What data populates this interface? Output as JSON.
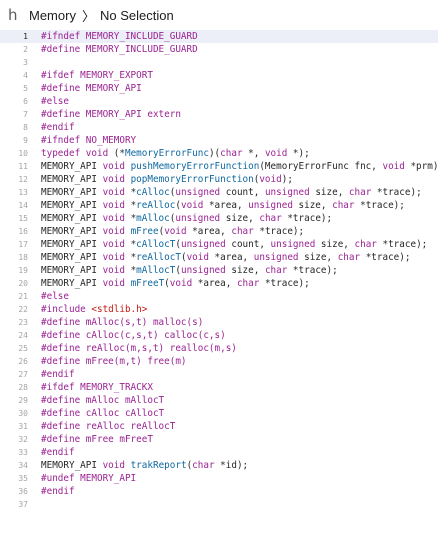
{
  "breadcrumb": {
    "file_icon": "h",
    "file": "Memory",
    "chevron": "〉",
    "selection": "No Selection"
  },
  "code": {
    "current_line": 1,
    "lines": [
      {
        "n": "1",
        "tokens": [
          {
            "t": "#ifndef MEMORY_INCLUDE_GUARD",
            "c": "k"
          }
        ]
      },
      {
        "n": "2",
        "tokens": [
          {
            "t": "#define MEMORY_INCLUDE_GUARD",
            "c": "k"
          }
        ]
      },
      {
        "n": "3",
        "tokens": []
      },
      {
        "n": "4",
        "tokens": [
          {
            "t": "#ifdef MEMORY_EXPORT",
            "c": "k"
          }
        ]
      },
      {
        "n": "5",
        "tokens": [
          {
            "t": "#define MEMORY_API",
            "c": "k"
          }
        ]
      },
      {
        "n": "6",
        "tokens": [
          {
            "t": "#else",
            "c": "k"
          }
        ]
      },
      {
        "n": "7",
        "tokens": [
          {
            "t": "#define MEMORY_API extern",
            "c": "k"
          }
        ]
      },
      {
        "n": "8",
        "tokens": [
          {
            "t": "#endif",
            "c": "k"
          }
        ]
      },
      {
        "n": "9",
        "tokens": [
          {
            "t": "#ifndef NO_MEMORY",
            "c": "k"
          }
        ]
      },
      {
        "n": "10",
        "tokens": [
          {
            "t": "typedef",
            "c": "k"
          },
          {
            "t": " ",
            "c": "p"
          },
          {
            "t": "void",
            "c": "k"
          },
          {
            "t": " (*",
            "c": "p"
          },
          {
            "t": "MemoryErrorFunc",
            "c": "f"
          },
          {
            "t": ")(",
            "c": "p"
          },
          {
            "t": "char",
            "c": "k"
          },
          {
            "t": " *, ",
            "c": "p"
          },
          {
            "t": "void",
            "c": "k"
          },
          {
            "t": " *);",
            "c": "p"
          }
        ]
      },
      {
        "n": "11",
        "tokens": [
          {
            "t": "MEMORY_API ",
            "c": "p"
          },
          {
            "t": "void",
            "c": "k"
          },
          {
            "t": " ",
            "c": "p"
          },
          {
            "t": "pushMemoryErrorFunction",
            "c": "f"
          },
          {
            "t": "(MemoryErrorFunc fnc, ",
            "c": "p"
          },
          {
            "t": "void",
            "c": "k"
          },
          {
            "t": " *prm);",
            "c": "p"
          }
        ]
      },
      {
        "n": "12",
        "tokens": [
          {
            "t": "MEMORY_API ",
            "c": "p"
          },
          {
            "t": "void",
            "c": "k"
          },
          {
            "t": " ",
            "c": "p"
          },
          {
            "t": "popMemoryErrorFunction",
            "c": "f"
          },
          {
            "t": "(",
            "c": "p"
          },
          {
            "t": "void",
            "c": "k"
          },
          {
            "t": ");",
            "c": "p"
          }
        ]
      },
      {
        "n": "13",
        "tokens": [
          {
            "t": "MEMORY_API ",
            "c": "p"
          },
          {
            "t": "void",
            "c": "k"
          },
          {
            "t": " *",
            "c": "p"
          },
          {
            "t": "cAlloc",
            "c": "f"
          },
          {
            "t": "(",
            "c": "p"
          },
          {
            "t": "unsigned",
            "c": "k"
          },
          {
            "t": " count, ",
            "c": "p"
          },
          {
            "t": "unsigned",
            "c": "k"
          },
          {
            "t": " size, ",
            "c": "p"
          },
          {
            "t": "char",
            "c": "k"
          },
          {
            "t": " *trace);",
            "c": "p"
          }
        ]
      },
      {
        "n": "14",
        "tokens": [
          {
            "t": "MEMORY_API ",
            "c": "p"
          },
          {
            "t": "void",
            "c": "k"
          },
          {
            "t": " *",
            "c": "p"
          },
          {
            "t": "reAlloc",
            "c": "f"
          },
          {
            "t": "(",
            "c": "p"
          },
          {
            "t": "void",
            "c": "k"
          },
          {
            "t": " *area, ",
            "c": "p"
          },
          {
            "t": "unsigned",
            "c": "k"
          },
          {
            "t": " size, ",
            "c": "p"
          },
          {
            "t": "char",
            "c": "k"
          },
          {
            "t": " *trace);",
            "c": "p"
          }
        ]
      },
      {
        "n": "15",
        "tokens": [
          {
            "t": "MEMORY_API ",
            "c": "p"
          },
          {
            "t": "void",
            "c": "k"
          },
          {
            "t": " *",
            "c": "p"
          },
          {
            "t": "mAlloc",
            "c": "f"
          },
          {
            "t": "(",
            "c": "p"
          },
          {
            "t": "unsigned",
            "c": "k"
          },
          {
            "t": " size, ",
            "c": "p"
          },
          {
            "t": "char",
            "c": "k"
          },
          {
            "t": " *trace);",
            "c": "p"
          }
        ]
      },
      {
        "n": "16",
        "tokens": [
          {
            "t": "MEMORY_API ",
            "c": "p"
          },
          {
            "t": "void",
            "c": "k"
          },
          {
            "t": " ",
            "c": "p"
          },
          {
            "t": "mFree",
            "c": "f"
          },
          {
            "t": "(",
            "c": "p"
          },
          {
            "t": "void",
            "c": "k"
          },
          {
            "t": " *area, ",
            "c": "p"
          },
          {
            "t": "char",
            "c": "k"
          },
          {
            "t": " *trace);",
            "c": "p"
          }
        ]
      },
      {
        "n": "17",
        "tokens": [
          {
            "t": "MEMORY_API ",
            "c": "p"
          },
          {
            "t": "void",
            "c": "k"
          },
          {
            "t": " *",
            "c": "p"
          },
          {
            "t": "cAllocT",
            "c": "f"
          },
          {
            "t": "(",
            "c": "p"
          },
          {
            "t": "unsigned",
            "c": "k"
          },
          {
            "t": " count, ",
            "c": "p"
          },
          {
            "t": "unsigned",
            "c": "k"
          },
          {
            "t": " size, ",
            "c": "p"
          },
          {
            "t": "char",
            "c": "k"
          },
          {
            "t": " *trace);",
            "c": "p"
          }
        ]
      },
      {
        "n": "18",
        "tokens": [
          {
            "t": "MEMORY_API ",
            "c": "p"
          },
          {
            "t": "void",
            "c": "k"
          },
          {
            "t": " *",
            "c": "p"
          },
          {
            "t": "reAllocT",
            "c": "f"
          },
          {
            "t": "(",
            "c": "p"
          },
          {
            "t": "void",
            "c": "k"
          },
          {
            "t": " *area, ",
            "c": "p"
          },
          {
            "t": "unsigned",
            "c": "k"
          },
          {
            "t": " size, ",
            "c": "p"
          },
          {
            "t": "char",
            "c": "k"
          },
          {
            "t": " *trace);",
            "c": "p"
          }
        ]
      },
      {
        "n": "19",
        "tokens": [
          {
            "t": "MEMORY_API ",
            "c": "p"
          },
          {
            "t": "void",
            "c": "k"
          },
          {
            "t": " *",
            "c": "p"
          },
          {
            "t": "mAllocT",
            "c": "f"
          },
          {
            "t": "(",
            "c": "p"
          },
          {
            "t": "unsigned",
            "c": "k"
          },
          {
            "t": " size, ",
            "c": "p"
          },
          {
            "t": "char",
            "c": "k"
          },
          {
            "t": " *trace);",
            "c": "p"
          }
        ]
      },
      {
        "n": "20",
        "tokens": [
          {
            "t": "MEMORY_API ",
            "c": "p"
          },
          {
            "t": "void",
            "c": "k"
          },
          {
            "t": " ",
            "c": "p"
          },
          {
            "t": "mFreeT",
            "c": "f"
          },
          {
            "t": "(",
            "c": "p"
          },
          {
            "t": "void",
            "c": "k"
          },
          {
            "t": " *area, ",
            "c": "p"
          },
          {
            "t": "char",
            "c": "k"
          },
          {
            "t": " *trace);",
            "c": "p"
          }
        ]
      },
      {
        "n": "21",
        "tokens": [
          {
            "t": "#else",
            "c": "k"
          }
        ]
      },
      {
        "n": "22",
        "tokens": [
          {
            "t": "#include ",
            "c": "k"
          },
          {
            "t": "<stdlib.h>",
            "c": "h"
          }
        ]
      },
      {
        "n": "23",
        "tokens": [
          {
            "t": "#define mAlloc(s,t) malloc(s)",
            "c": "k"
          }
        ]
      },
      {
        "n": "24",
        "tokens": [
          {
            "t": "#define cAlloc(c,s,t) calloc(c,s)",
            "c": "k"
          }
        ]
      },
      {
        "n": "25",
        "tokens": [
          {
            "t": "#define reAlloc(m,s,t) realloc(m,s)",
            "c": "k"
          }
        ]
      },
      {
        "n": "26",
        "tokens": [
          {
            "t": "#define mFree(m,t) free(m)",
            "c": "k"
          }
        ]
      },
      {
        "n": "27",
        "tokens": [
          {
            "t": "#endif",
            "c": "k"
          }
        ]
      },
      {
        "n": "28",
        "tokens": [
          {
            "t": "#ifdef MEMORY_TRACKX",
            "c": "k"
          }
        ]
      },
      {
        "n": "29",
        "tokens": [
          {
            "t": "#define mAlloc mAllocT",
            "c": "k"
          }
        ]
      },
      {
        "n": "30",
        "tokens": [
          {
            "t": "#define cAlloc cAllocT",
            "c": "k"
          }
        ]
      },
      {
        "n": "31",
        "tokens": [
          {
            "t": "#define reAlloc reAllocT",
            "c": "k"
          }
        ]
      },
      {
        "n": "32",
        "tokens": [
          {
            "t": "#define mFree mFreeT",
            "c": "k"
          }
        ]
      },
      {
        "n": "33",
        "tokens": [
          {
            "t": "#endif",
            "c": "k"
          }
        ]
      },
      {
        "n": "34",
        "tokens": [
          {
            "t": "MEMORY_API ",
            "c": "p"
          },
          {
            "t": "void",
            "c": "k"
          },
          {
            "t": " ",
            "c": "p"
          },
          {
            "t": "trakReport",
            "c": "f"
          },
          {
            "t": "(",
            "c": "p"
          },
          {
            "t": "char",
            "c": "k"
          },
          {
            "t": " *id);",
            "c": "p"
          }
        ]
      },
      {
        "n": "35",
        "tokens": [
          {
            "t": "#undef MEMORY_API",
            "c": "k"
          }
        ]
      },
      {
        "n": "36",
        "tokens": [
          {
            "t": "#endif",
            "c": "k"
          }
        ]
      },
      {
        "n": "37",
        "tokens": []
      }
    ]
  }
}
